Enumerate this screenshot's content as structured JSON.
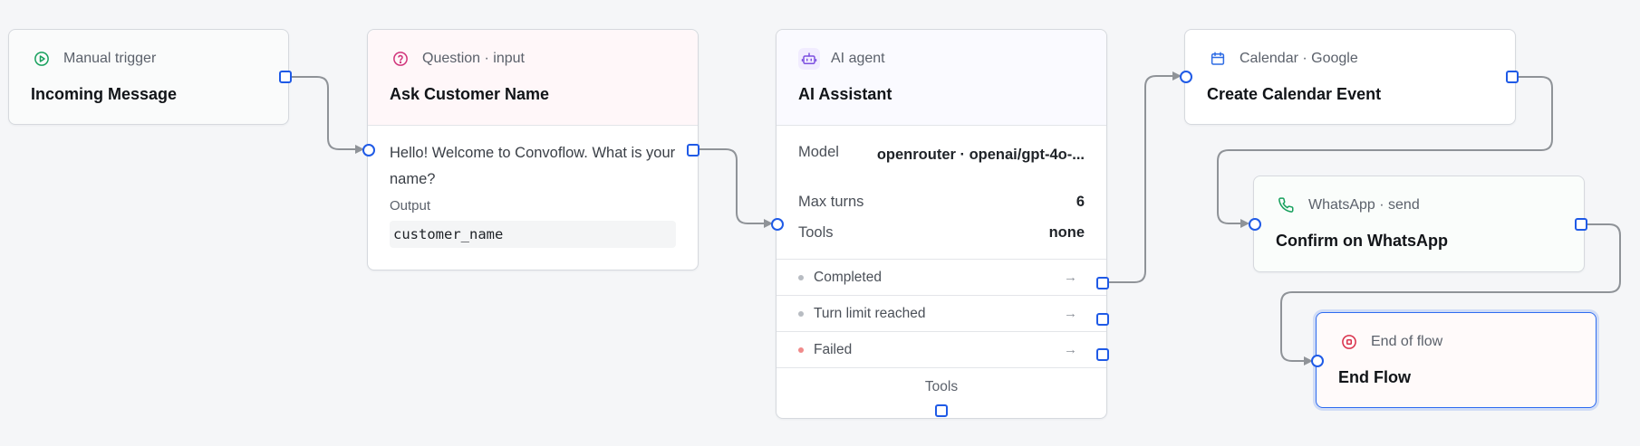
{
  "colors": {
    "edge": "#8f9398",
    "port": "#1f5ae6",
    "selection": "#2e6bf0"
  },
  "nodes": {
    "trigger": {
      "kind": "Manual trigger",
      "icon": "play-circle-icon",
      "title": "Incoming Message"
    },
    "question": {
      "kind": "Question · input",
      "icon": "help-circle-icon",
      "title": "Ask Customer Name",
      "text": "Hello! Welcome to Convoflow. What is your name?",
      "output_label": "Output",
      "output_var": "customer_name"
    },
    "agent": {
      "kind": "AI agent",
      "icon": "bot-icon",
      "title": "AI Assistant",
      "model_label": "Model",
      "model_value": "openrouter · openai/gpt-4o-...",
      "max_turns_label": "Max turns",
      "max_turns_value": "6",
      "tools_label": "Tools",
      "tools_value": "none",
      "outcomes": [
        "Completed",
        "Turn limit reached",
        "Failed"
      ],
      "tools_footer": "Tools"
    },
    "calendar": {
      "kind": "Calendar · Google",
      "icon": "calendar-icon",
      "title": "Create Calendar Event"
    },
    "whatsapp": {
      "kind": "WhatsApp · send",
      "icon": "phone-icon",
      "title": "Confirm on WhatsApp"
    },
    "end": {
      "kind": "End of flow",
      "icon": "stop-circle-icon",
      "title": "End Flow"
    }
  }
}
